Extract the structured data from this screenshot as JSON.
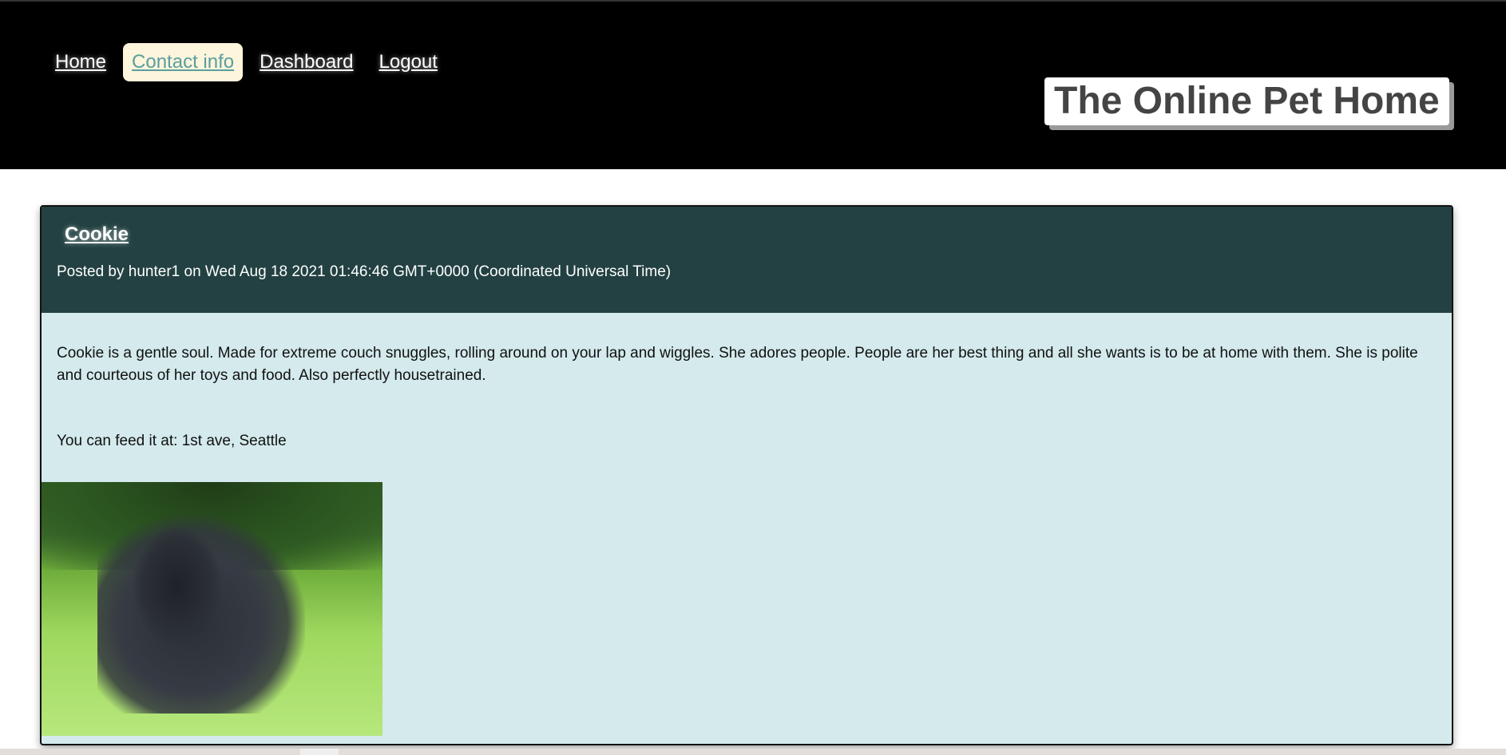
{
  "nav": {
    "items": [
      {
        "label": "Home"
      },
      {
        "label": "Contact info"
      },
      {
        "label": "Dashboard"
      },
      {
        "label": "Logout"
      }
    ],
    "active": "Contact info"
  },
  "site_title": "The Online Pet Home",
  "post": {
    "name": "Cookie",
    "posted_line": "Posted by hunter1 on Wed Aug 18 2021 01:46:46 GMT+0000 (Coordinated Universal Time)",
    "description": "Cookie is a gentle soul. Made for extreme couch snuggles, rolling around on your lap and wiggles. She adores people. People are her best thing and all she wants is to be at home with them. She is polite and courteous of her toys and food. Also perfectly housetrained.",
    "feed_line": "You can feed it at: 1st ave, Seattle"
  },
  "colors": {
    "header_bg": "#000000",
    "card_head": "#234142",
    "card_body": "#d4eaec",
    "active_nav_bg": "#fdf5dc"
  }
}
